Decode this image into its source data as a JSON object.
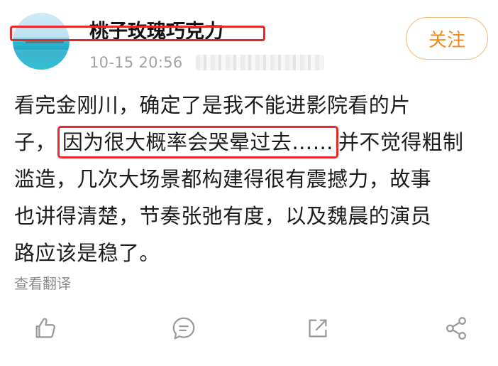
{
  "post": {
    "username": "桃子玫瑰巧克力",
    "timestamp": "10-15 20:56",
    "follow_label": "关注",
    "body_lines": [
      "看完金刚川，确定了是我不能进影院看的片",
      "子，",
      "因为很大概率会哭晕过去……",
      "并不觉得粗制",
      "滥造，几次大场景都构建得很有震撼力，故事",
      "也讲得清楚，节奏张弛有度，以及魏晨的演员",
      "路应该是稳了。"
    ],
    "translate_label": "查看翻译"
  },
  "actions": [
    {
      "name": "like",
      "icon": "thumbs-up-icon"
    },
    {
      "name": "comment",
      "icon": "comment-bubble-icon"
    },
    {
      "name": "repost",
      "icon": "share-out-icon"
    },
    {
      "name": "share",
      "icon": "share-nodes-icon"
    }
  ],
  "colors": {
    "accent": "#f28a1b",
    "highlight_box": "#e52a2a",
    "meta_text": "#a3a3a3",
    "icon": "#9a9a9a"
  }
}
